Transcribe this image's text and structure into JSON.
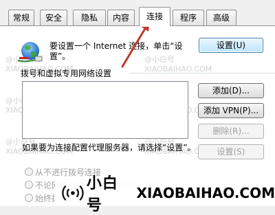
{
  "tabs": [
    {
      "label": "常规"
    },
    {
      "label": "安全"
    },
    {
      "label": "隐私"
    },
    {
      "label": "内容"
    },
    {
      "label": "连接",
      "active": true
    },
    {
      "label": "程序"
    },
    {
      "label": "高级"
    }
  ],
  "setup": {
    "text": "要设置一个 Internet 连接，单击“设置”。",
    "button": "设置(U)"
  },
  "dialup": {
    "section_title": "拨号和虚拟专用网络设置",
    "add_button": "添加(D)...",
    "add_vpn_button": "添加 VPN(P)...",
    "remove_button": "删除(R)...",
    "settings_button": "设置(S)"
  },
  "proxy": {
    "text": "如果要为连接配置代理服务器，请选择“设置”。"
  },
  "radios": [
    {
      "label": "从不进行拨号连接"
    },
    {
      "label": "不论网络连接是否存在都进行拨号"
    },
    {
      "label": "始终拨打默认连接"
    }
  ],
  "watermark": {
    "small_cn": "@小白号",
    "small_en": "XIAOBAIHAO.COM",
    "brand_cn": "小白号",
    "brand_en": "XIAOBAIHAO.COM"
  },
  "colors": {
    "arrow": "#c0392b",
    "primary_border": "#3c7fb1",
    "disabled_text": "#a0a0a0"
  }
}
